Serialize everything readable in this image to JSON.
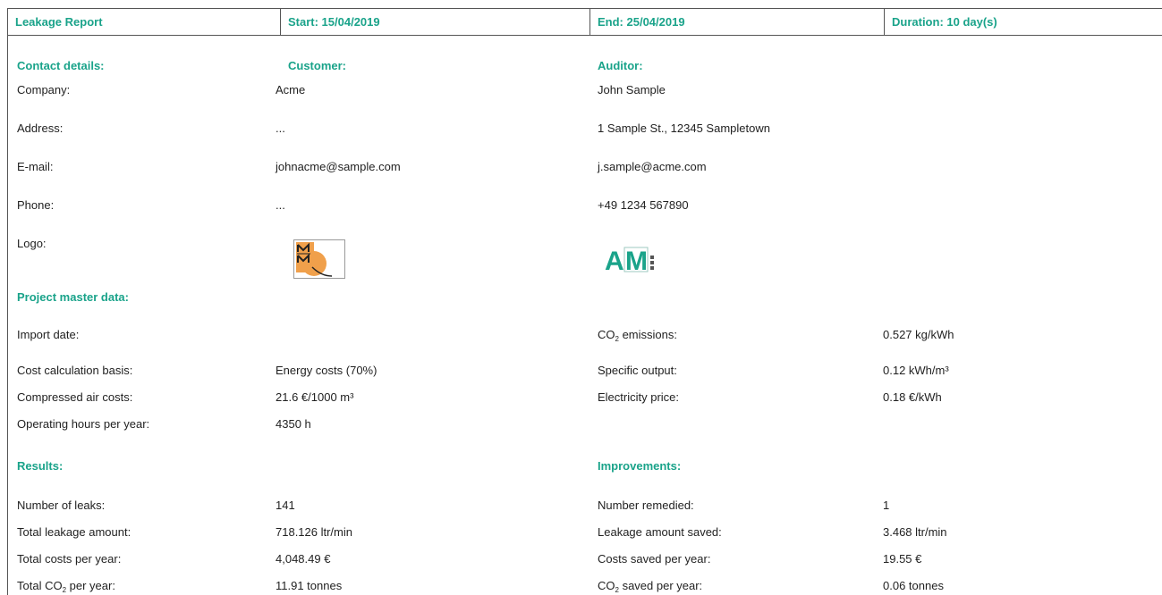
{
  "header": {
    "title": "Leakage Report",
    "start": "Start: 15/04/2019",
    "end": "End: 25/04/2019",
    "duration": "Duration: 10 day(s)"
  },
  "contact": {
    "section": "Contact details:",
    "customer_heading": "Customer:",
    "auditor_heading": "Auditor:",
    "rows": [
      {
        "label": "Company:",
        "customer": "Acme",
        "auditor": "John Sample"
      },
      {
        "label": "Address:",
        "customer": "...",
        "auditor": "1 Sample St., 12345 Sampletown"
      },
      {
        "label": "E-mail:",
        "customer": "johnacme@sample.com",
        "auditor": "j.sample@acme.com"
      },
      {
        "label": "Phone:",
        "customer": "...",
        "auditor": "+49 1234 567890"
      },
      {
        "label": "Logo:"
      }
    ],
    "auditor_logo_text": "AM"
  },
  "project": {
    "section": "Project master data:",
    "import_date_label": "Import date:",
    "import_date_value": "",
    "co2_emissions_label_pre": "CO",
    "co2_sub": "2",
    "co2_emissions_label_post": " emissions:",
    "co2_emissions_value": "0.527 kg/kWh",
    "cost_basis_label": "Cost calculation basis:",
    "cost_basis_value": "Energy costs (70%)",
    "specific_output_label": "Specific output:",
    "specific_output_value": "0.12 kWh/m³",
    "air_costs_label": "Compressed air costs:",
    "air_costs_value": "21.6 €/1000 m³",
    "electricity_label": "Electricity price:",
    "electricity_value": "0.18 €/kWh",
    "hours_label": "Operating hours per year:",
    "hours_value": "4350 h"
  },
  "results": {
    "section": "Results:",
    "leaks_label": "Number of leaks:",
    "leaks_value": "141",
    "leak_amount_label": "Total leakage amount:",
    "leak_amount_value": "718.126 ltr/min",
    "costs_label": "Total costs per year:",
    "costs_value": "4,048.49 €",
    "co2_label_pre": "Total CO",
    "co2_label_post": " per year:",
    "co2_value": "11.91 tonnes"
  },
  "improvements": {
    "section": "Improvements:",
    "remedied_label": "Number remedied:",
    "remedied_value": "1",
    "saved_amount_label": "Leakage amount saved:",
    "saved_amount_value": "3.468 ltr/min",
    "costs_saved_label": "Costs saved per year:",
    "costs_saved_value": "19.55 €",
    "co2_saved_label_pre": "CO",
    "co2_saved_label_post": " saved per year:",
    "co2_saved_value": "0.06 tonnes"
  },
  "colors": {
    "accent": "#1aa38a",
    "border": "#555555"
  }
}
